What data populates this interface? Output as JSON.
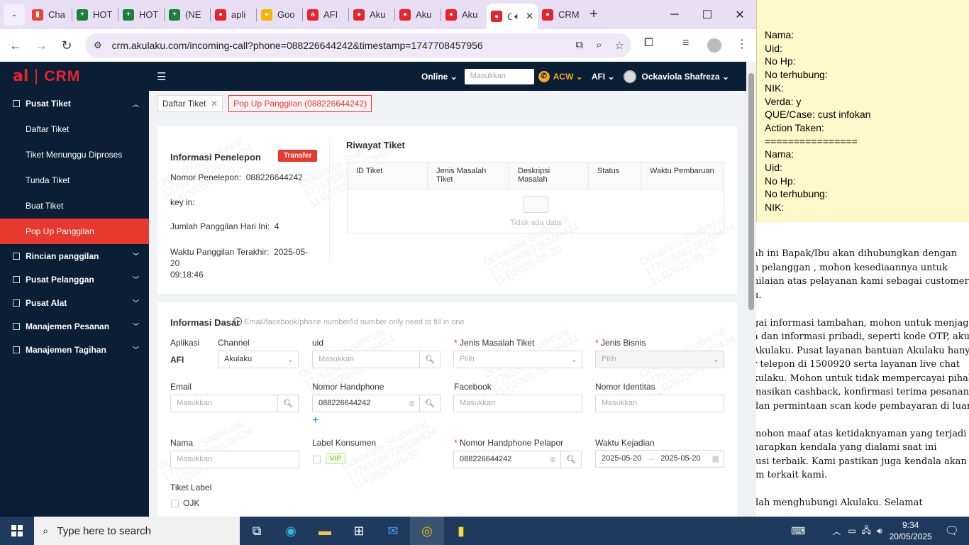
{
  "browser": {
    "tabs": [
      {
        "label": "Cha",
        "color": "#ea4335",
        "glyph": "▮"
      },
      {
        "label": "HOT",
        "color": "#188038",
        "glyph": "+"
      },
      {
        "label": "HOT",
        "color": "#188038",
        "glyph": "+"
      },
      {
        "label": "(NE",
        "color": "#188038",
        "glyph": "+"
      },
      {
        "label": "apli",
        "color": "#e8222a",
        "glyph": "●"
      },
      {
        "label": "Goo",
        "color": "#f4b400",
        "glyph": "●"
      },
      {
        "label": "AFI",
        "color": "#e8222a",
        "glyph": "a"
      },
      {
        "label": "Aku",
        "color": "#e8222a",
        "glyph": "●"
      },
      {
        "label": "Aku",
        "color": "#e8222a",
        "glyph": "●"
      },
      {
        "label": "Aku",
        "color": "#e8222a",
        "glyph": "●"
      },
      {
        "label": "C",
        "color": "#e8222a",
        "glyph": "●"
      },
      {
        "label": "CRM",
        "color": "#e8222a",
        "glyph": "●"
      }
    ],
    "url": "crm.akulaku.com/incoming-call?phone=088226644242&timestamp=1747708457956"
  },
  "crm": {
    "logo_small": "al",
    "logo_text": "CRM",
    "status": "Online",
    "search_placeholder": "Masukkan",
    "acw": "ACW",
    "app": "AFI",
    "user": "Ockaviola Shafreza"
  },
  "sidebar": {
    "head": "Pusat Tiket",
    "subs": [
      "Daftar Tiket",
      "Tiket Menunggu Diproses",
      "Tunda Tiket",
      "Buat Tiket",
      "Pop Up Panggilan"
    ],
    "groups": [
      "Rincian panggilan",
      "Pusat Pelanggan",
      "Pusat Alat",
      "Manajemen Pesanan",
      "Manajemen Tagihan"
    ]
  },
  "tags": {
    "t1": "Daftar Tiket",
    "t2": "Pop Up Panggilan (088226644242)"
  },
  "caller": {
    "title": "Informasi Penelepon",
    "transfer": "Transfer",
    "phone_label": "Nomor Penelepon:",
    "phone": "088226644242",
    "keyin": "key in:",
    "count_label": "Jumlah Panggilan Hari Ini:",
    "count": "4",
    "last_label": "Waktu Panggilan Terakhir:",
    "last_date": "2025-05-20",
    "last_time": "09:18:46"
  },
  "history": {
    "title": "Riwayat Tiket",
    "columns": [
      "ID Tiket",
      "Jenis Masalah Tiket",
      "Deskripsi Masalah",
      "Status",
      "Waktu Pembaruan"
    ],
    "empty": "Tidak ada data"
  },
  "watermark": {
    "l1": "Ockaviola Shafreza(",
    "l2": "17761686736108424",
    "l3": "114)2025-05-20"
  },
  "basic": {
    "title": "Informasi Dasar",
    "hint": "Email/facebook/phone number/id number only need to fill in one",
    "aplikasi_label": "Aplikasi",
    "aplikasi": "AFI",
    "channel_label": "Channel",
    "channel": "Akulaku",
    "uid_label": "uid",
    "uid_ph": "Masukkan",
    "jenis_masalah_label": "Jenis Masalah Tiket",
    "pilih": "Pilih",
    "jenis_bisnis_label": "Jenis Bisnis",
    "email_label": "Email",
    "email_ph": "Masukkan",
    "hp_label": "Nomor Handphone",
    "hp": "088226644242",
    "fb_label": "Facebook",
    "fb_ph": "Masukkan",
    "nid_label": "Nomor Identitas",
    "nid_ph": "Masukkan",
    "nama_label": "Nama",
    "nama_ph": "Masukkan",
    "konsumen_label": "Label Konsumen",
    "vip": "VIP",
    "pelapor_label": "Nomor Handphone Pelapor",
    "pelapor": "088226644242",
    "waktu_label": "Waktu Kejadian",
    "date_from": "2025-05-20",
    "date_to": "2025-05-20",
    "tiket_label": "Tiket Label",
    "ojk": "OJK"
  },
  "note": {
    "lines": [
      "Nama:",
      "Uid:",
      "No Hp:",
      "No terhubung:",
      "NIK:",
      "Verda: y",
      "QUE/Case: cust infokan",
      "Action Taken:",
      "================",
      "Nama:",
      "Uid:",
      "No Hp:",
      "No terhubung:",
      "NIK:"
    ]
  },
  "doc": {
    "lines": [
      "ah ini Bapak/Ibu akan dihubungkan dengan",
      "n pelanggan , mohon kesediaannya untuk",
      "nilaian atas pelayanan kami sebagai customer",
      "u.",
      "",
      "gai informasi tambahan, mohon untuk menjaga",
      "a dan informasi pribadi, seperti kode OTP, akun,",
      "Akulaku. Pusat layanan bantuan Akulaku hanya",
      "r telepon di 1500920 serta layanan live chat",
      "kulaku. Mohon untuk tidak mempercayai pihak",
      "masikan cashback, konfirmasi terima pesanan,",
      "dan permintaan scan kode pembayaran di luar",
      "",
      "mohon maaf atas ketidaknyaman yang terjadi",
      "harapkan kendala yang dialami saat ini",
      "lusi terbaik. Kami pastikan juga kendala akan",
      "im terkait kami.",
      "",
      "dah menghubungi Akulaku. Selamat"
    ]
  },
  "taskbar": {
    "search": "Type here to search",
    "time": "9:34",
    "date": "20/05/2025"
  }
}
